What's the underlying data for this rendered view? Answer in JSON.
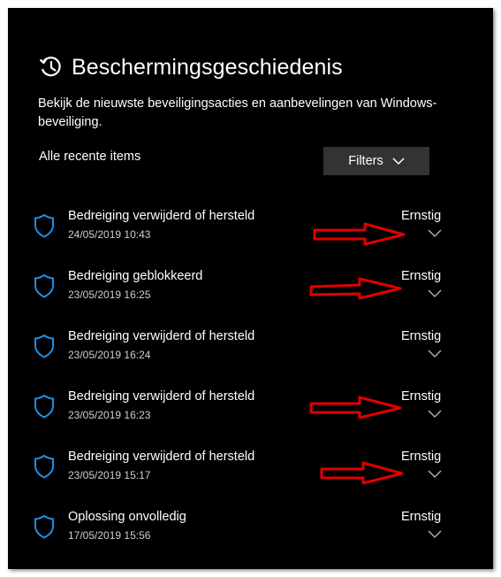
{
  "page": {
    "title": "Beschermingsgeschiedenis",
    "description": "Bekijk de nieuwste beveiligingsacties en aanbevelingen van Windows-beveiliging.",
    "section_label": "Alle recente items",
    "filters_label": "Filters"
  },
  "items": [
    {
      "title": "Bedreiging verwijderd of hersteld",
      "date": "24/05/2019 10:43",
      "severity": "Ernstig"
    },
    {
      "title": "Bedreiging geblokkeerd",
      "date": "23/05/2019 16:25",
      "severity": "Ernstig"
    },
    {
      "title": "Bedreiging verwijderd of hersteld",
      "date": "23/05/2019 16:24",
      "severity": "Ernstig"
    },
    {
      "title": "Bedreiging verwijderd of hersteld",
      "date": "23/05/2019 16:23",
      "severity": "Ernstig"
    },
    {
      "title": "Bedreiging verwijderd of hersteld",
      "date": "23/05/2019 15:17",
      "severity": "Ernstig"
    },
    {
      "title": "Oplossing onvolledig",
      "date": "17/05/2019 15:56",
      "severity": "Ernstig"
    }
  ],
  "icons": {
    "header": "history-icon",
    "item": "shield-icon",
    "expand": "chevron-down-icon",
    "filters": "chevron-down-icon"
  },
  "colors": {
    "background": "#000000",
    "shield": "#1e8fe6",
    "annotation_arrow": "#e00000",
    "button": "#333333"
  }
}
